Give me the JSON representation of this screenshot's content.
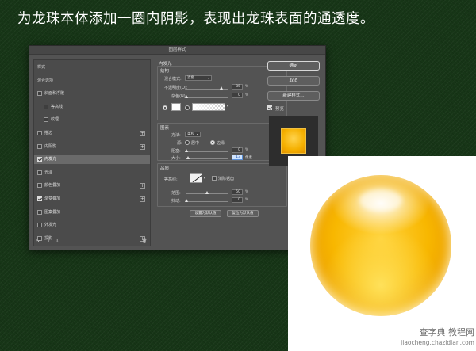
{
  "caption": "为龙珠本体添加一圈内阴影，表现出龙珠表面的通透度。",
  "dialog": {
    "title": "图层样式",
    "styles_list": [
      {
        "label": "样式",
        "checkbox": false,
        "checked": false,
        "plus": false,
        "indent": false,
        "selected": false
      },
      {
        "label": "混合选项",
        "checkbox": false,
        "checked": false,
        "plus": false,
        "indent": false,
        "selected": false
      },
      {
        "label": "斜面和浮雕",
        "checkbox": true,
        "checked": false,
        "plus": false,
        "indent": false,
        "selected": false
      },
      {
        "label": "等高线",
        "checkbox": true,
        "checked": false,
        "plus": false,
        "indent": true,
        "selected": false
      },
      {
        "label": "纹理",
        "checkbox": true,
        "checked": false,
        "plus": false,
        "indent": true,
        "selected": false
      },
      {
        "label": "描边",
        "checkbox": true,
        "checked": false,
        "plus": true,
        "indent": false,
        "selected": false
      },
      {
        "label": "内阴影",
        "checkbox": true,
        "checked": false,
        "plus": true,
        "indent": false,
        "selected": false
      },
      {
        "label": "内发光",
        "checkbox": true,
        "checked": true,
        "plus": false,
        "indent": false,
        "selected": true
      },
      {
        "label": "光泽",
        "checkbox": true,
        "checked": false,
        "plus": false,
        "indent": false,
        "selected": false
      },
      {
        "label": "颜色叠加",
        "checkbox": true,
        "checked": false,
        "plus": true,
        "indent": false,
        "selected": false
      },
      {
        "label": "渐变叠加",
        "checkbox": true,
        "checked": true,
        "plus": true,
        "indent": false,
        "selected": false
      },
      {
        "label": "图案叠加",
        "checkbox": true,
        "checked": false,
        "plus": false,
        "indent": false,
        "selected": false
      },
      {
        "label": "外发光",
        "checkbox": true,
        "checked": false,
        "plus": false,
        "indent": false,
        "selected": false
      },
      {
        "label": "投影",
        "checkbox": true,
        "checked": false,
        "plus": true,
        "indent": false,
        "selected": false
      }
    ],
    "list_footer": {
      "fx": "fx.",
      "up": "⬆",
      "down": "⬇",
      "trash": "🗑"
    },
    "inner_glow": {
      "section_title": "内发光",
      "structure": {
        "title": "结构",
        "blend_mode_label": "混合模式:",
        "blend_mode_value": "滤色",
        "opacity_label": "不透明度(O):",
        "opacity_value": "85",
        "opacity_level": 0.85,
        "noise_label": "杂色(N):",
        "noise_value": "0",
        "noise_level": 0,
        "percent": "%"
      },
      "elements": {
        "title": "图素",
        "method_label": "方法:",
        "method_value": "柔和",
        "source_label": "源:",
        "source_center": "居中",
        "source_edge": "边缘",
        "source_selected": "edge",
        "choke_label": "阻塞:",
        "choke_value": "0",
        "choke_level": 0,
        "size_label": "大小:",
        "size_value": "13",
        "size_level": 0.05,
        "percent": "%",
        "pixels": "像素"
      },
      "quality": {
        "title": "品质",
        "contour_label": "等高线:",
        "antialias_label": "消除锯齿",
        "range_label": "范围:",
        "range_value": "50",
        "range_level": 0.5,
        "jitter_label": "抖动:",
        "jitter_value": "0",
        "jitter_level": 0,
        "percent": "%"
      },
      "make_default": "设置为默认值",
      "reset_default": "复位为默认值"
    },
    "buttons": {
      "ok": "确定",
      "cancel": "取消",
      "new_style": "新建样式...",
      "preview_label": "预览",
      "preview_checked": true
    }
  },
  "watermark": {
    "line1": "查字典 教程网",
    "line2": "jiaocheng.chazidian.com"
  },
  "colors": {
    "background": "#173617",
    "dialog": "#535353",
    "gold": "#f8b700"
  }
}
